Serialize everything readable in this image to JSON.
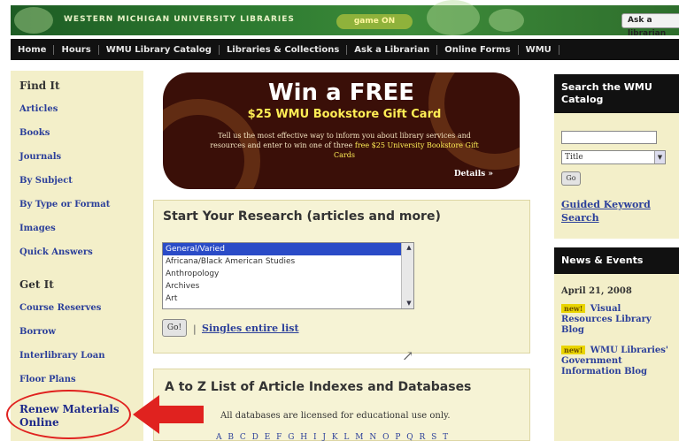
{
  "header": {
    "title": "WESTERN MICHIGAN UNIVERSITY LIBRARIES",
    "badge": "game ON",
    "ask_button": "Ask a librarian"
  },
  "nav": [
    "Home",
    "Hours",
    "WMU Library Catalog",
    "Libraries & Collections",
    "Ask a Librarian",
    "Online Forms",
    "WMU"
  ],
  "left_sidebar": {
    "find_heading": "Find It",
    "find_links": [
      "Articles",
      "Books",
      "Journals",
      "By Subject",
      "By Type or Format",
      "Images",
      "Quick Answers"
    ],
    "get_heading": "Get It",
    "get_links": [
      "Course Reserves",
      "Borrow",
      "Interlibrary Loan",
      "Floor Plans"
    ]
  },
  "banner": {
    "headline": "Win a FREE",
    "card": "$25 WMU Bookstore Gift Card",
    "body_pre": "Tell us the most effective way to inform you about library services and resources and enter to win one of three",
    "body_highlight": "free $25 University Bookstore Gift Cards",
    "details": "Details »"
  },
  "research": {
    "heading": "Start Your Research (articles and more)",
    "options": [
      "General/Varied",
      "Africana/Black American Studies",
      "Anthropology",
      "Archives",
      "Art"
    ],
    "selected_index": 0,
    "go_label": "Go!",
    "separator": "|",
    "link": "Singles entire list"
  },
  "atoz": {
    "heading": "A to Z List of Article Indexes and Databases",
    "note": "All databases are licensed for educational use only.",
    "letters": "A B C D E F G H I J K L M N O P Q R S T"
  },
  "catalog": {
    "heading": "Search the WMU Catalog",
    "search_value": "",
    "select_value": "Title",
    "go_label": "Go",
    "guided_link": "Guided Keyword Search"
  },
  "news": {
    "heading": "News & Events",
    "date": "April 21, 2008",
    "new_tag": "new!",
    "items": [
      "Visual Resources Library Blog",
      "WMU Libraries' Government Information Blog"
    ]
  },
  "annotation": {
    "renew_text": "Renew Materials Online",
    "oval_color": "#e0221f",
    "arrow_color": "#e0221f"
  },
  "colors": {
    "header_green": "#2d7a30",
    "nav_black": "#111111",
    "sidebar_cream": "#f3efc9",
    "link_blue": "#2b3f9a"
  }
}
